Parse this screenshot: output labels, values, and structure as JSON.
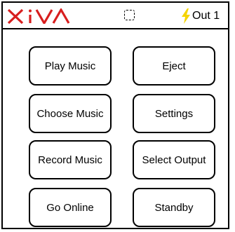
{
  "header": {
    "logo_text": "XIVA",
    "status_icon": "dashed-square-icon",
    "output_icon": "lightning-bolt-icon",
    "output_label": "Out 1"
  },
  "menu": {
    "play_music": "Play Music",
    "eject": "Eject",
    "choose_music": "Choose Music",
    "settings": "Settings",
    "record_music": "Record Music",
    "select_output": "Select Output",
    "go_online": "Go Online",
    "standby": "Standby"
  },
  "colors": {
    "logo": "#d81e1e",
    "bolt": "#f5d400",
    "border": "#000000",
    "background": "#ffffff"
  }
}
